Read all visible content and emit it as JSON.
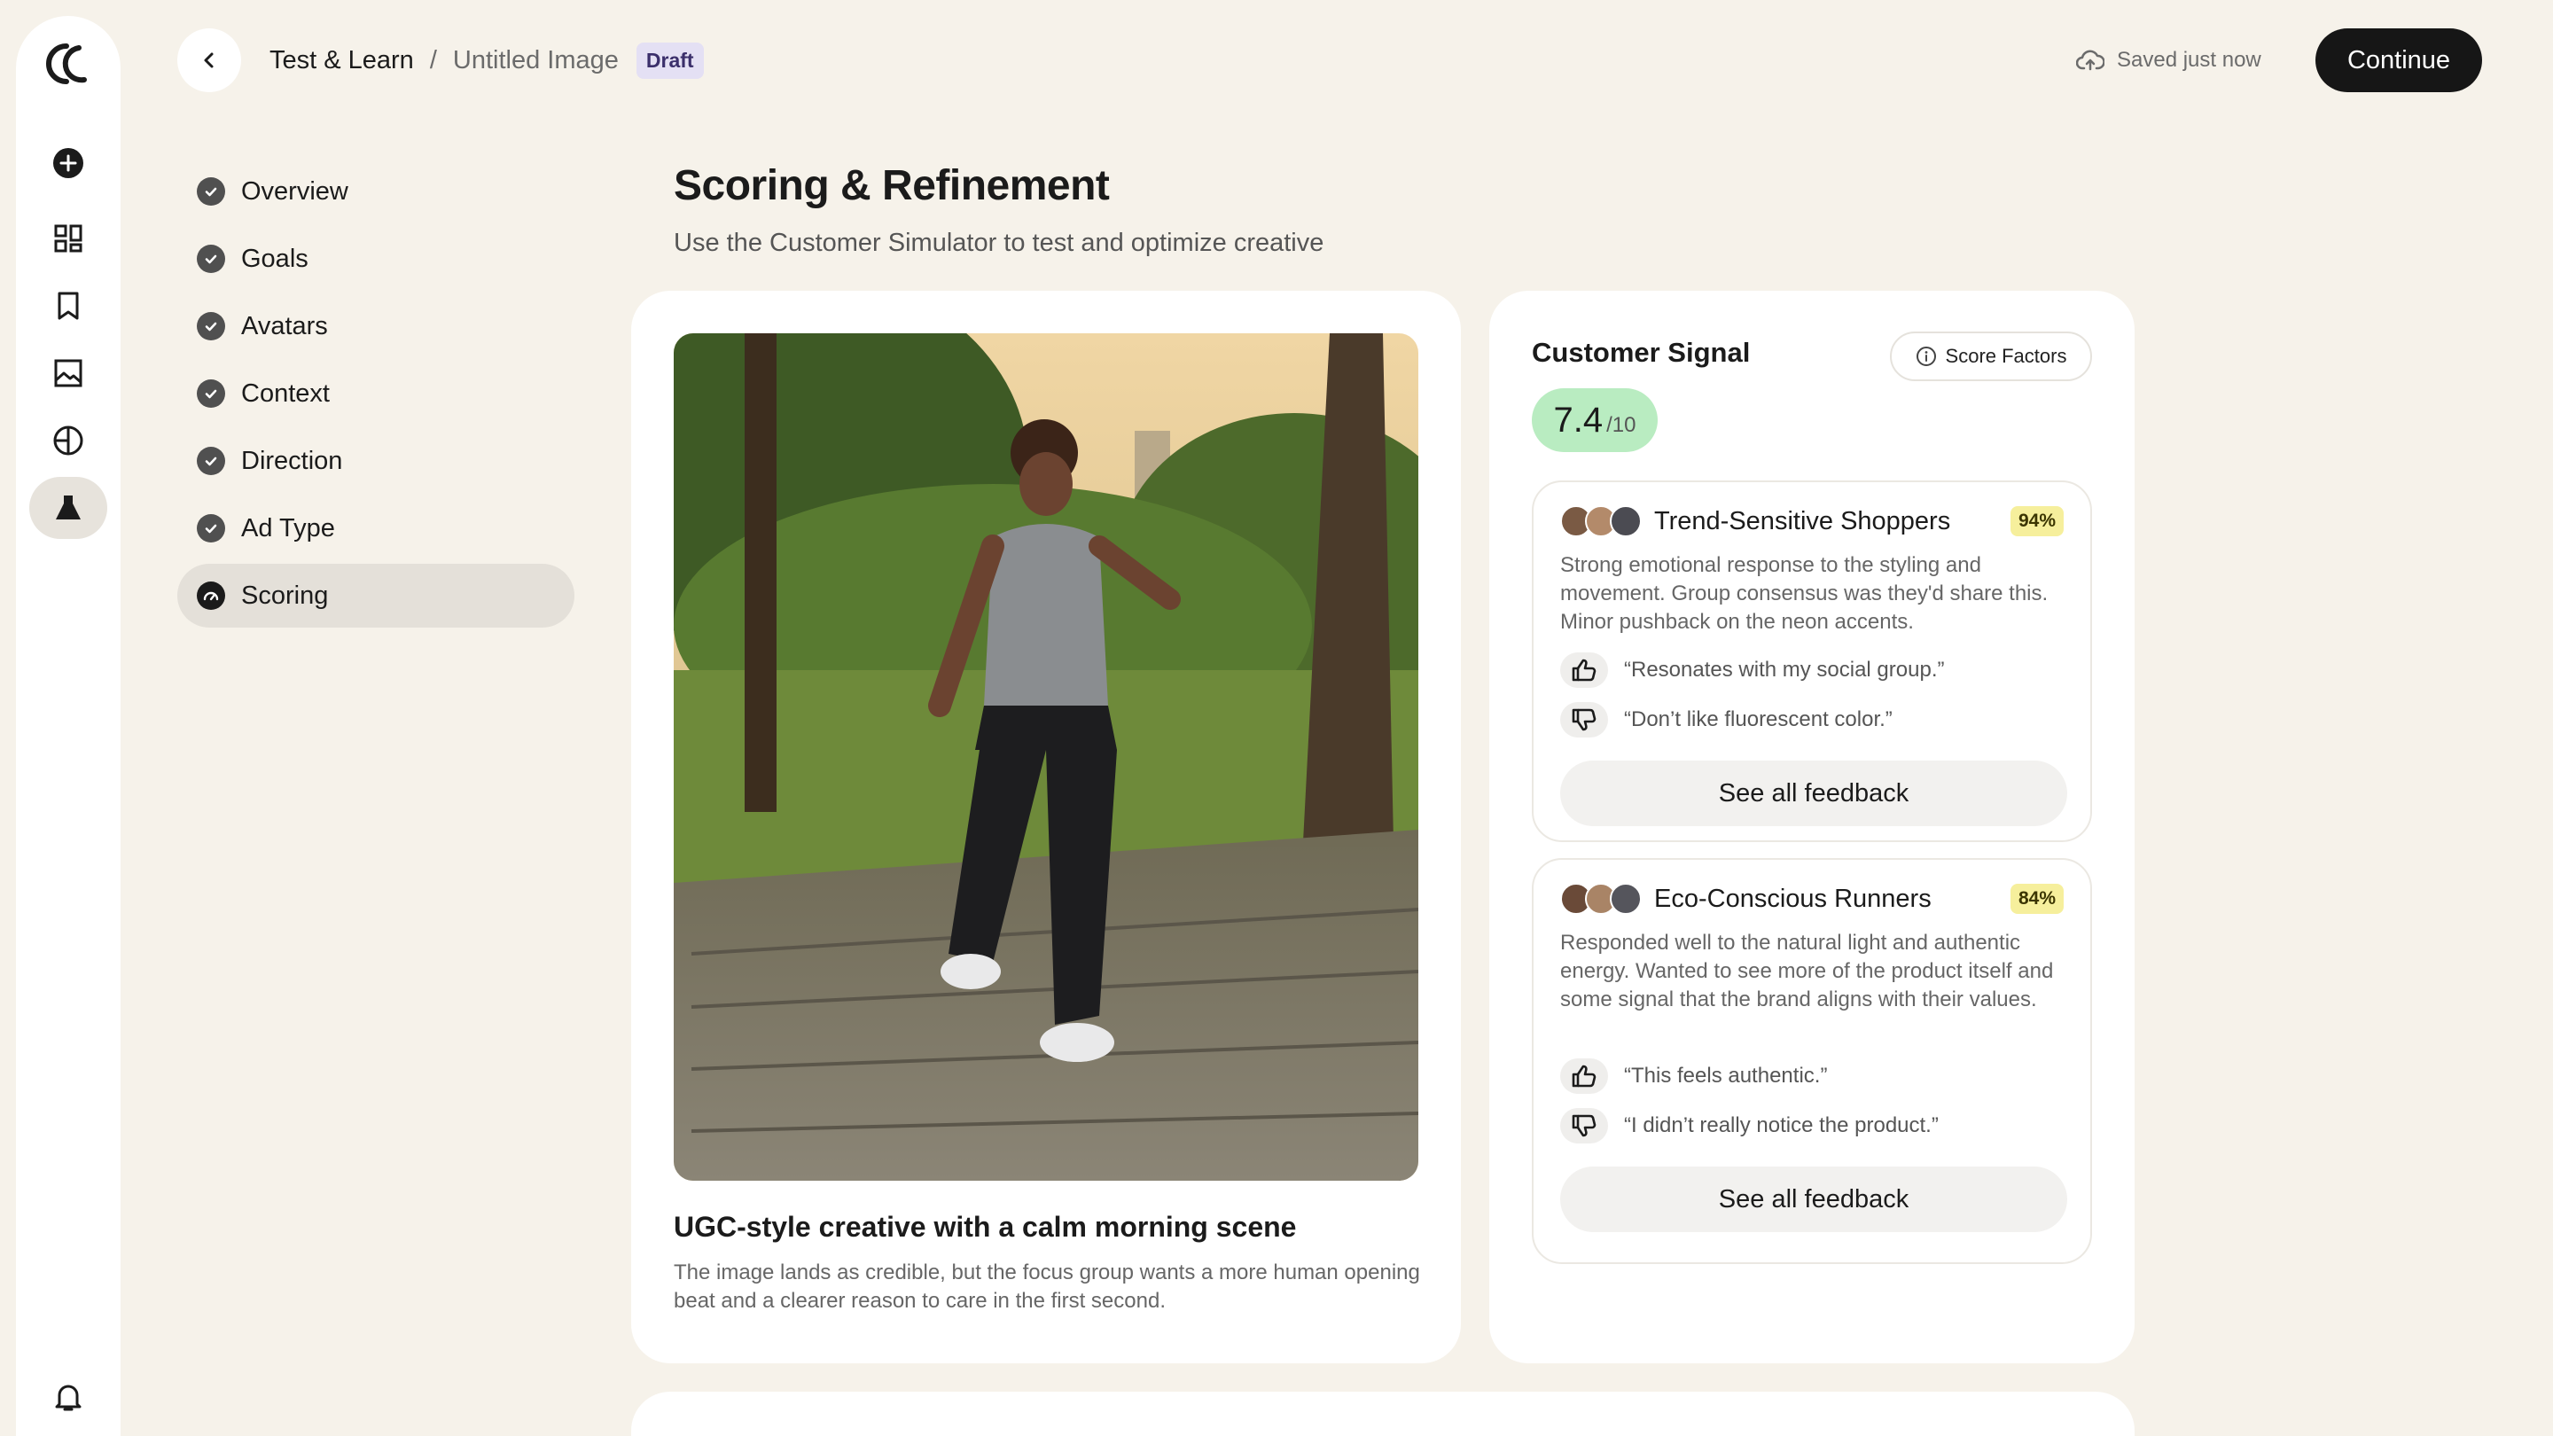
{
  "nav": {
    "rail": [
      "logo-icon",
      "plus-circle-icon",
      "dashboard-icon",
      "bookmark-icon",
      "image-icon",
      "half-circle-icon",
      "flask-icon",
      "bell-icon"
    ]
  },
  "breadcrumb": {
    "root": "Test & Learn",
    "separator": "/",
    "current": "Untitled Image",
    "badge": "Draft"
  },
  "topbar": {
    "saved_text": "Saved just now",
    "continue_label": "Continue"
  },
  "steps": [
    {
      "label": "Overview",
      "status": "done"
    },
    {
      "label": "Goals",
      "status": "done"
    },
    {
      "label": "Avatars",
      "status": "done"
    },
    {
      "label": "Context",
      "status": "done"
    },
    {
      "label": "Direction",
      "status": "done"
    },
    {
      "label": "Ad Type",
      "status": "done"
    },
    {
      "label": "Scoring",
      "status": "active"
    }
  ],
  "page": {
    "title": "Scoring & Refinement",
    "subtitle": "Use the Customer Simulator to test and optimize creative"
  },
  "creative": {
    "title": "UGC-style creative with a calm morning scene",
    "description": "The image lands as credible, but the focus group wants a more human opening beat and a clearer reason to care in the first second."
  },
  "signal": {
    "title": "Customer Signal",
    "score_factors_label": "Score Factors",
    "score": "7.4",
    "score_max": "/10",
    "segments": [
      {
        "name": "Trend-Sensitive Shoppers",
        "match": "94%",
        "description": "Strong emotional response to the styling and movement. Group consensus was they'd share this. Minor pushback on the neon accents.",
        "positive_quote": "“Resonates with my social group.”",
        "negative_quote": "“Don’t like fluorescent color.”",
        "button": "See all feedback"
      },
      {
        "name": "Eco-Conscious Runners",
        "match": "84%",
        "description": "Responded well to the natural light and authentic energy. Wanted to see more of the product itself and some signal that the brand aligns with their values.",
        "positive_quote": "“This feels authentic.”",
        "negative_quote": "“I didn’t really notice the product.”",
        "button": "See all feedback"
      }
    ]
  },
  "colors": {
    "background": "#f6f2ea",
    "score_pill": "#b9ecc1",
    "match_badge": "#f6ef9c",
    "draft_badge": "#e4e0f4",
    "primary_button": "#161616"
  }
}
